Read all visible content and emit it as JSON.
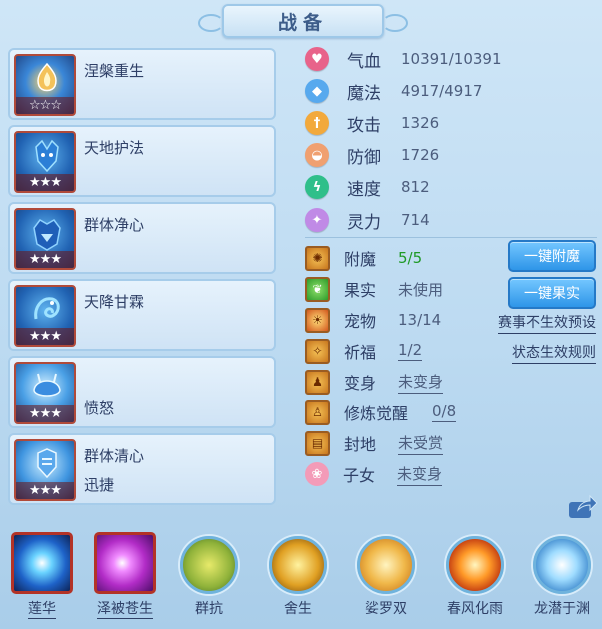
{
  "title": "战备",
  "cards": [
    {
      "name": "涅槃重生",
      "sub": "",
      "stars": "☆☆☆",
      "icon": "flame-helmet-icon",
      "color": "#b04a3a"
    },
    {
      "name": "天地护法",
      "sub": "",
      "stars": "★★★",
      "icon": "blue-demon-icon",
      "color": "#b04a3a"
    },
    {
      "name": "群体净心",
      "sub": "",
      "stars": "★★★",
      "icon": "blue-warrior-icon",
      "color": "#b04a3a"
    },
    {
      "name": "天降甘霖",
      "sub": "",
      "stars": "★★★",
      "icon": "blue-dragon-icon",
      "color": "#b04a3a"
    },
    {
      "name": "",
      "sub": "愤怒",
      "stars": "★★★",
      "icon": "ice-beast-icon",
      "color": "#b04a3a"
    },
    {
      "name": "群体清心",
      "sub": "迅捷",
      "stars": "★★★",
      "icon": "ice-guardian-icon",
      "color": "#b04a3a"
    }
  ],
  "stats": [
    {
      "label": "气血",
      "value": "10391/10391",
      "icon": "heart-icon",
      "color": "#e8638a"
    },
    {
      "label": "魔法",
      "value": "4917/4917",
      "icon": "mana-crystal-icon",
      "color": "#57a9ee"
    },
    {
      "label": "攻击",
      "value": "1326",
      "icon": "sword-icon",
      "color": "#f2a93c"
    },
    {
      "label": "防御",
      "value": "1726",
      "icon": "shield-icon",
      "color": "#f0a070"
    },
    {
      "label": "速度",
      "value": "812",
      "icon": "lightning-icon",
      "color": "#2fbf8a"
    },
    {
      "label": "灵力",
      "value": "714",
      "icon": "spirit-icon",
      "color": "#c08ae6"
    }
  ],
  "rows": [
    {
      "label": "附魔",
      "value": "5/5",
      "icon": "enchant-icon"
    },
    {
      "label": "果实",
      "value": "未使用",
      "icon": "fruit-icon"
    },
    {
      "label": "宠物",
      "value": "13/14",
      "icon": "pet-icon"
    },
    {
      "label": "祈福",
      "value": "1/2",
      "icon": "blessing-icon"
    },
    {
      "label": "变身",
      "value": "未变身",
      "icon": "transform-icon"
    },
    {
      "label": "修炼觉醒",
      "value": "0/8",
      "icon": "cultivation-icon"
    },
    {
      "label": "封地",
      "value": "未受赏",
      "icon": "fief-icon"
    },
    {
      "label": "子女",
      "value": "未变身",
      "icon": "children-icon"
    }
  ],
  "buttons": {
    "enchant_all": "一键附魔",
    "fruit_all": "一键果实"
  },
  "links": {
    "event_preset": "赛事不生效预设",
    "status_rules": "状态生效规则"
  },
  "skills": [
    {
      "name": "莲华",
      "icon": "lotus-orb-icon",
      "shape": "square"
    },
    {
      "name": "泽被苍生",
      "icon": "blessing-hand-icon",
      "shape": "square"
    },
    {
      "name": "群抗",
      "icon": "shield-grid-icon",
      "shape": "round"
    },
    {
      "name": "舍生",
      "icon": "self-sacrifice-icon",
      "shape": "round"
    },
    {
      "name": "娑罗双",
      "icon": "twin-hands-icon",
      "shape": "round"
    },
    {
      "name": "春风化雨",
      "icon": "fire-burst-icon",
      "shape": "round"
    },
    {
      "name": "龙潜于渊",
      "icon": "dragon-head-icon",
      "shape": "round"
    }
  ]
}
